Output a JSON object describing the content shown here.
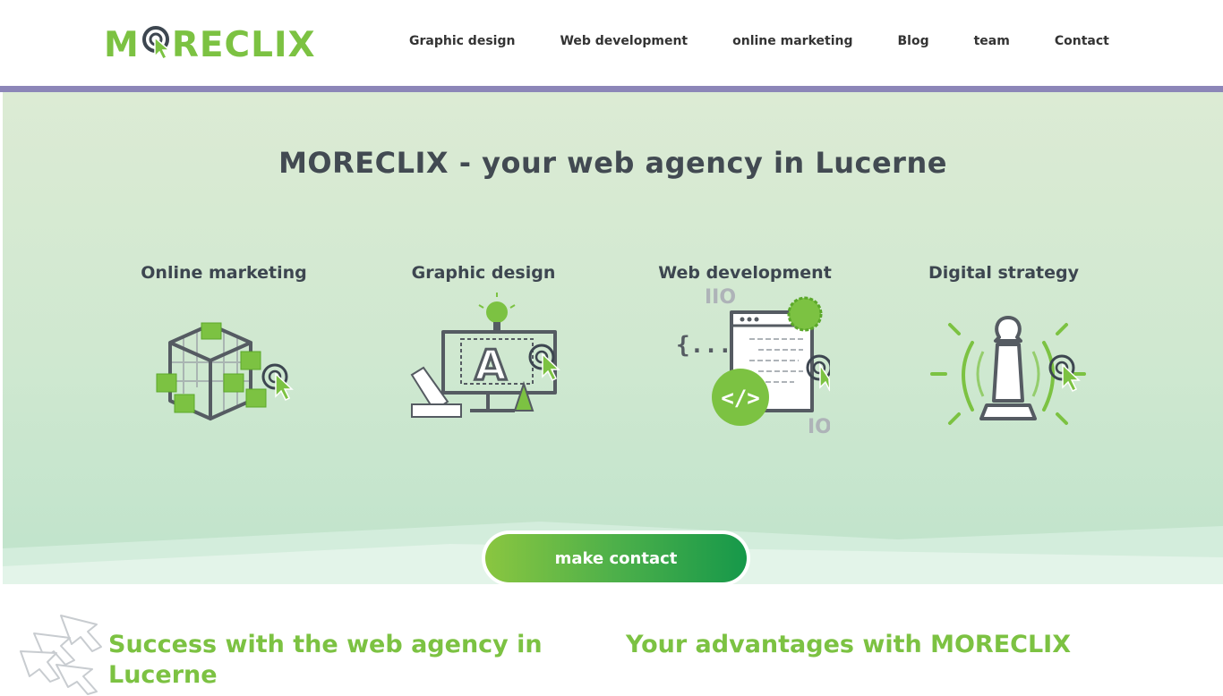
{
  "header": {
    "logo_text_m": "M",
    "logo_text_rest": "RECLIX",
    "nav": [
      {
        "label": "Graphic design"
      },
      {
        "label": "Web development"
      },
      {
        "label": "online marketing"
      },
      {
        "label": "Blog"
      },
      {
        "label": "team"
      },
      {
        "label": "Contact"
      }
    ]
  },
  "hero": {
    "title": "MORECLIX - your web agency in Lucerne",
    "services": [
      {
        "title": "Online marketing",
        "icon": "cube-icon"
      },
      {
        "title": "Graphic design",
        "icon": "design-screen-icon"
      },
      {
        "title": "Web development",
        "icon": "code-window-icon"
      },
      {
        "title": "Digital strategy",
        "icon": "chess-pawn-icon"
      }
    ],
    "cta_label": "make contact"
  },
  "bottom": {
    "left_heading": "Success with the web agency in Lucerne",
    "right_heading": "Your advantages with MORECLIX"
  },
  "colors": {
    "brand_green": "#7cc242",
    "dark_gray": "#3d4650",
    "accent_purple": "#8c86b8"
  }
}
